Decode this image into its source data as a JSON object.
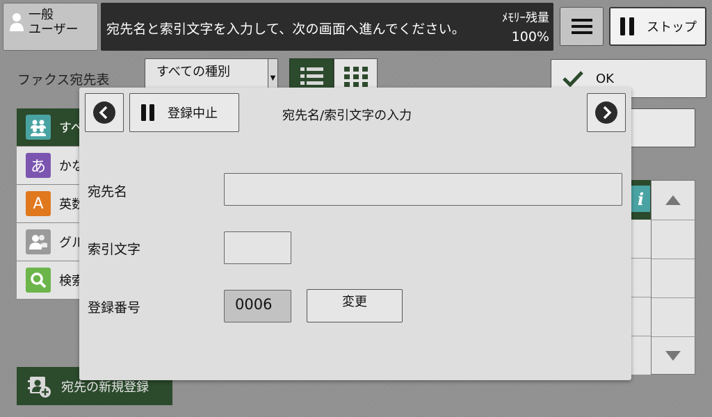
{
  "header": {
    "user_label": "一般\nユーザー",
    "message": "宛先名と索引文字を入力して、次の画面へ進んでください。",
    "memory_label": "ﾒﾓﾘｰ残量",
    "memory_value": "100%",
    "stop_label": "ストップ"
  },
  "background": {
    "fax_title": "ファクス宛先表",
    "type_select_value": "すべての種別",
    "ok_label": "OK",
    "side_items": [
      {
        "label": "すべて",
        "icon": "all-contacts-icon"
      },
      {
        "label": "かな",
        "icon": "hiragana-icon",
        "glyph": "あ"
      },
      {
        "label": "英数",
        "icon": "alphabet-icon",
        "glyph": "A"
      },
      {
        "label": "グループ",
        "icon": "group-icon"
      },
      {
        "label": "検索",
        "icon": "search-icon"
      }
    ],
    "new_registration_label": "宛先の新規登録"
  },
  "dialog": {
    "cancel_label": "登録中止",
    "title": "宛先名/索引文字の入力",
    "fields": {
      "name_label": "宛先名",
      "name_value": "",
      "index_label": "索引文字",
      "index_value": "",
      "reg_number_label": "登録番号",
      "reg_number_value": "0006",
      "change_label": "変更"
    }
  },
  "colors": {
    "accent_green": "#2c4a2c",
    "header_dark": "#2c2c2c",
    "info_teal": "#4aa3a3",
    "hiragana_purple": "#7c55b0",
    "alphabet_orange": "#e0781e",
    "search_green": "#6bb54a"
  }
}
